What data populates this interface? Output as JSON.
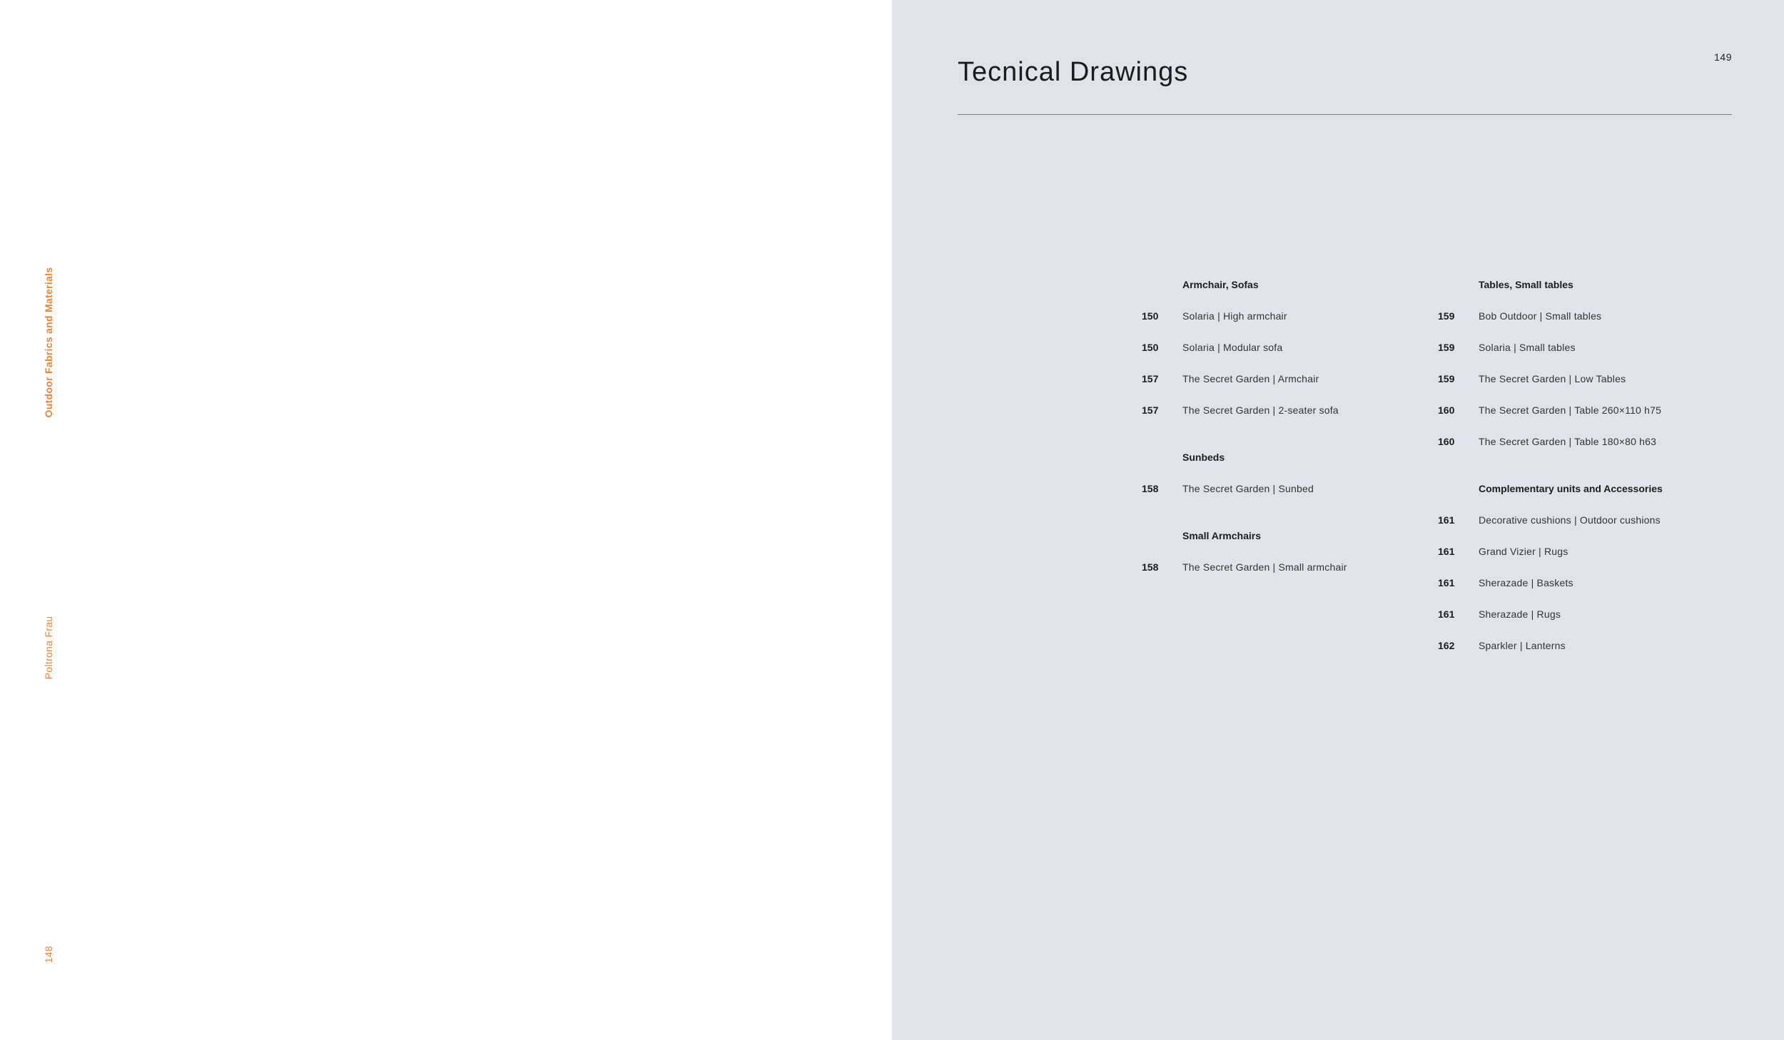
{
  "left_page": {
    "section_label": "Outdoor Fabrics and Materials",
    "brand": "Poltrona Frau",
    "page_number": "148"
  },
  "right_page": {
    "page_number": "149",
    "title": "Tecnical Drawings",
    "columns": [
      {
        "sections": [
          {
            "heading": "Armchair, Sofas",
            "entries": [
              {
                "page": "150",
                "label": "Solaria | High armchair"
              },
              {
                "page": "150",
                "label": "Solaria | Modular sofa"
              },
              {
                "page": "157",
                "label": "The Secret Garden | Armchair"
              },
              {
                "page": "157",
                "label": "The Secret Garden | 2-seater sofa"
              }
            ]
          },
          {
            "heading": "Sunbeds",
            "entries": [
              {
                "page": "158",
                "label": "The Secret Garden | Sunbed"
              }
            ]
          },
          {
            "heading": "Small Armchairs",
            "entries": [
              {
                "page": "158",
                "label": "The Secret Garden | Small armchair"
              }
            ]
          }
        ]
      },
      {
        "sections": [
          {
            "heading": "Tables, Small tables",
            "entries": [
              {
                "page": "159",
                "label": "Bob Outdoor | Small tables"
              },
              {
                "page": "159",
                "label": "Solaria | Small tables"
              },
              {
                "page": "159",
                "label": "The Secret Garden | Low Tables"
              },
              {
                "page": "160",
                "label": "The Secret Garden | Table 260×110 h75"
              },
              {
                "page": "160",
                "label": "The Secret Garden | Table 180×80 h63"
              }
            ]
          },
          {
            "heading": "Complementary units and Accessories",
            "entries": [
              {
                "page": "161",
                "label": "Decorative cushions | Outdoor cushions"
              },
              {
                "page": "161",
                "label": "Grand Vizier | Rugs"
              },
              {
                "page": "161",
                "label": "Sherazade | Baskets"
              },
              {
                "page": "161",
                "label": "Sherazade | Rugs"
              },
              {
                "page": "162",
                "label": "Sparkler | Lanterns"
              }
            ]
          }
        ]
      }
    ]
  },
  "colors": {
    "accent_orange": "#e8843e",
    "right_page_background": "#e0e4ea"
  }
}
